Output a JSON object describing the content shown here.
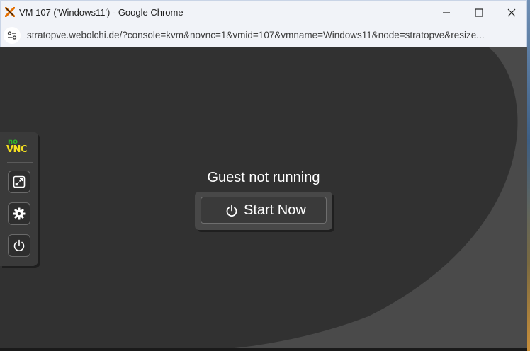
{
  "window": {
    "title": "VM 107 ('Windows11') - Google Chrome",
    "app_icon": "proxmox-x-icon",
    "controls": [
      "minimize-icon",
      "maximize-icon",
      "close-icon"
    ]
  },
  "address_bar": {
    "url": "stratopve.webolchi.de/?console=kvm&novnc=1&vmid=107&vmname=Windows11&node=stratopve&resize...",
    "site_info_icon": "site-settings-icon"
  },
  "novnc": {
    "logo_top": "no",
    "logo_bottom": "VNC",
    "buttons": [
      {
        "icon": "fullscreen-icon"
      },
      {
        "icon": "gear-icon"
      },
      {
        "icon": "power-icon"
      }
    ]
  },
  "status": {
    "message": "Guest not running",
    "start_label": "Start Now",
    "start_icon": "power-icon"
  },
  "colors": {
    "accent_green": "#2fb52a",
    "accent_yellow": "#f5e020",
    "background": "#313131"
  }
}
